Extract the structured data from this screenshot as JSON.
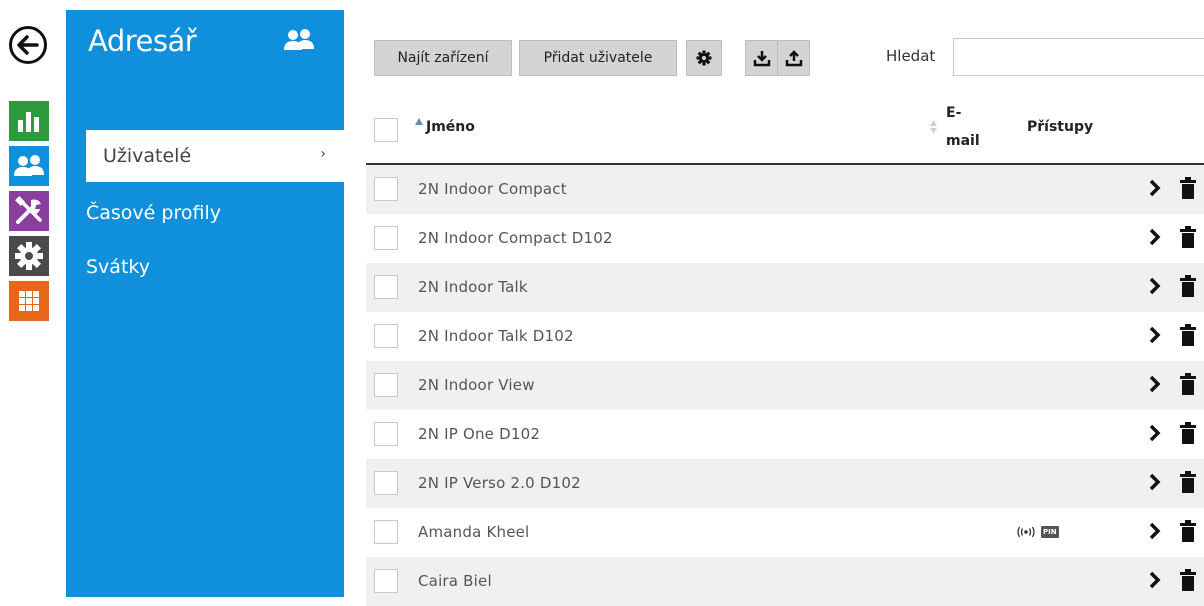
{
  "rail": {
    "items": [
      {
        "icon": "back-arrow-icon"
      },
      {
        "icon": "status-chart-icon",
        "color": "#2e9a3e"
      },
      {
        "icon": "users-icon",
        "color": "#0f8fdc"
      },
      {
        "icon": "tools-icon",
        "color": "#8a3e9e"
      },
      {
        "icon": "gear-icon",
        "color": "#4a4a4a"
      },
      {
        "icon": "grid-icon",
        "color": "#e8661a"
      }
    ]
  },
  "nav": {
    "title": "Adresář",
    "items": [
      {
        "label": "Uživatelé",
        "active": true
      },
      {
        "label": "Časové profily",
        "active": false
      },
      {
        "label": "Svátky",
        "active": false
      }
    ],
    "chevron": "›"
  },
  "toolbar": {
    "find_devices": "Najít zařízení",
    "add_user": "Přidat uživatele",
    "search_label": "Hledat",
    "search_value": ""
  },
  "table": {
    "headers": {
      "name": "Jméno",
      "email_line1": "E-",
      "email_line2": "mail",
      "access": "Přístupy"
    },
    "rows": [
      {
        "name": "2N Indoor Compact",
        "access": []
      },
      {
        "name": "2N Indoor Compact D102",
        "access": []
      },
      {
        "name": "2N Indoor Talk",
        "access": []
      },
      {
        "name": "2N Indoor Talk D102",
        "access": []
      },
      {
        "name": "2N Indoor View",
        "access": []
      },
      {
        "name": "2N IP One D102",
        "access": []
      },
      {
        "name": "2N IP Verso 2.0 D102",
        "access": []
      },
      {
        "name": "Amanda Kheel",
        "access": [
          "rfid",
          "pin"
        ],
        "pin_label": "PIN"
      },
      {
        "name": "Caira Biel",
        "access": []
      }
    ]
  },
  "colors": {
    "accent_blue": "#0f8fdc",
    "status_green": "#2e9a3e",
    "tools_purple": "#8a3e9e",
    "settings_gray": "#4a4a4a",
    "grid_orange": "#e8661a"
  }
}
